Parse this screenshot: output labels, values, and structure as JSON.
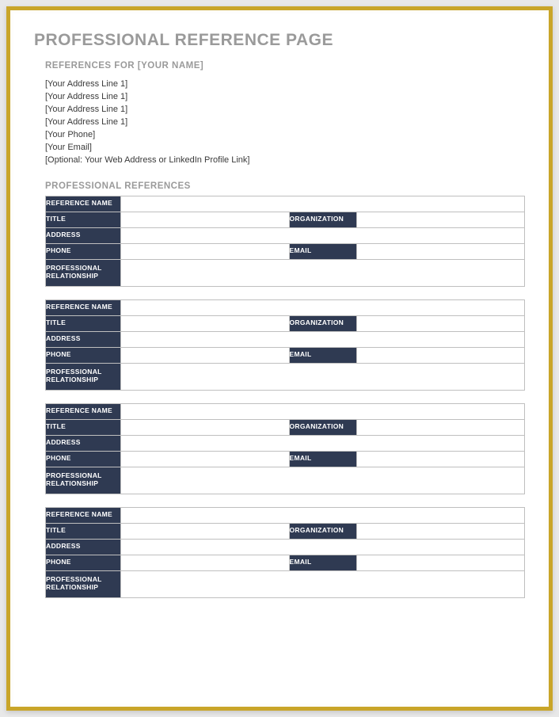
{
  "title": "PROFESSIONAL REFERENCE PAGE",
  "references_for_label": "REFERENCES FOR [YOUR NAME]",
  "contact_lines": [
    "[Your Address Line 1]",
    "[Your Address Line 1]",
    "[Your Address Line 1]",
    "[Your Address Line 1]",
    "[Your Phone]",
    "[Your Email]",
    "[Optional: Your Web Address or LinkedIn Profile Link]"
  ],
  "section_title": "PROFESSIONAL REFERENCES",
  "field_labels": {
    "reference_name": "REFERENCE NAME",
    "title": "TITLE",
    "organization": "ORGANIZATION",
    "address": "ADDRESS",
    "phone": "PHONE",
    "email": "EMAIL",
    "professional_relationship": "PROFESSIONAL RELATIONSHIP"
  },
  "reference_blocks": [
    {
      "reference_name": "",
      "title": "",
      "organization": "",
      "address": "",
      "phone": "",
      "email": "",
      "professional_relationship": ""
    },
    {
      "reference_name": "",
      "title": "",
      "organization": "",
      "address": "",
      "phone": "",
      "email": "",
      "professional_relationship": ""
    },
    {
      "reference_name": "",
      "title": "",
      "organization": "",
      "address": "",
      "phone": "",
      "email": "",
      "professional_relationship": ""
    },
    {
      "reference_name": "",
      "title": "",
      "organization": "",
      "address": "",
      "phone": "",
      "email": "",
      "professional_relationship": ""
    }
  ]
}
